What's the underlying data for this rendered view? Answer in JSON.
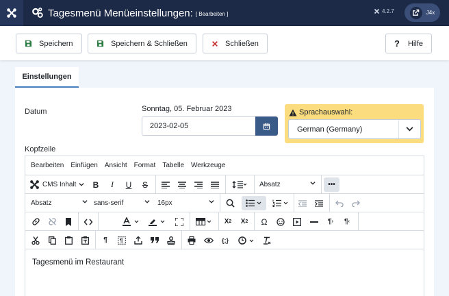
{
  "header": {
    "title": "Tagesmenü Menüeinstellungen:",
    "title_badge": "[ Bearbeiten ]",
    "version": "4.2.7",
    "user_label": "J4x"
  },
  "toolbar": {
    "save_label": "Speichern",
    "save_close_label": "Speichern & Schließen",
    "close_label": "Schließen",
    "help_label": "Hilfe"
  },
  "tabs": [
    {
      "label": "Einstellungen"
    }
  ],
  "form": {
    "date_label": "Datum",
    "date_caption": "Sonntag, 05. Februar 2023",
    "date_value": "2023-02-05",
    "language_label": "Sprachauswahl:",
    "language_value": "German (Germany)",
    "header_label": "Kopfzeile"
  },
  "editor": {
    "menus": [
      "Bearbeiten",
      "Einfügen",
      "Ansicht",
      "Format",
      "Tabelle",
      "Werkzeuge"
    ],
    "cms_content_label": "CMS Inhalt",
    "block_format_1": "Absatz",
    "block_format_2": "Absatz",
    "font_family": "sans-serif",
    "font_size": "16px",
    "content_text": "Tagesmenü im Restaurant"
  },
  "colors": {
    "header_bg": "#1c2a47",
    "accent": "#457dbd",
    "warning_bg": "#fbdc7f",
    "save_icon": "#2f7d45",
    "close_icon": "#c52827"
  }
}
